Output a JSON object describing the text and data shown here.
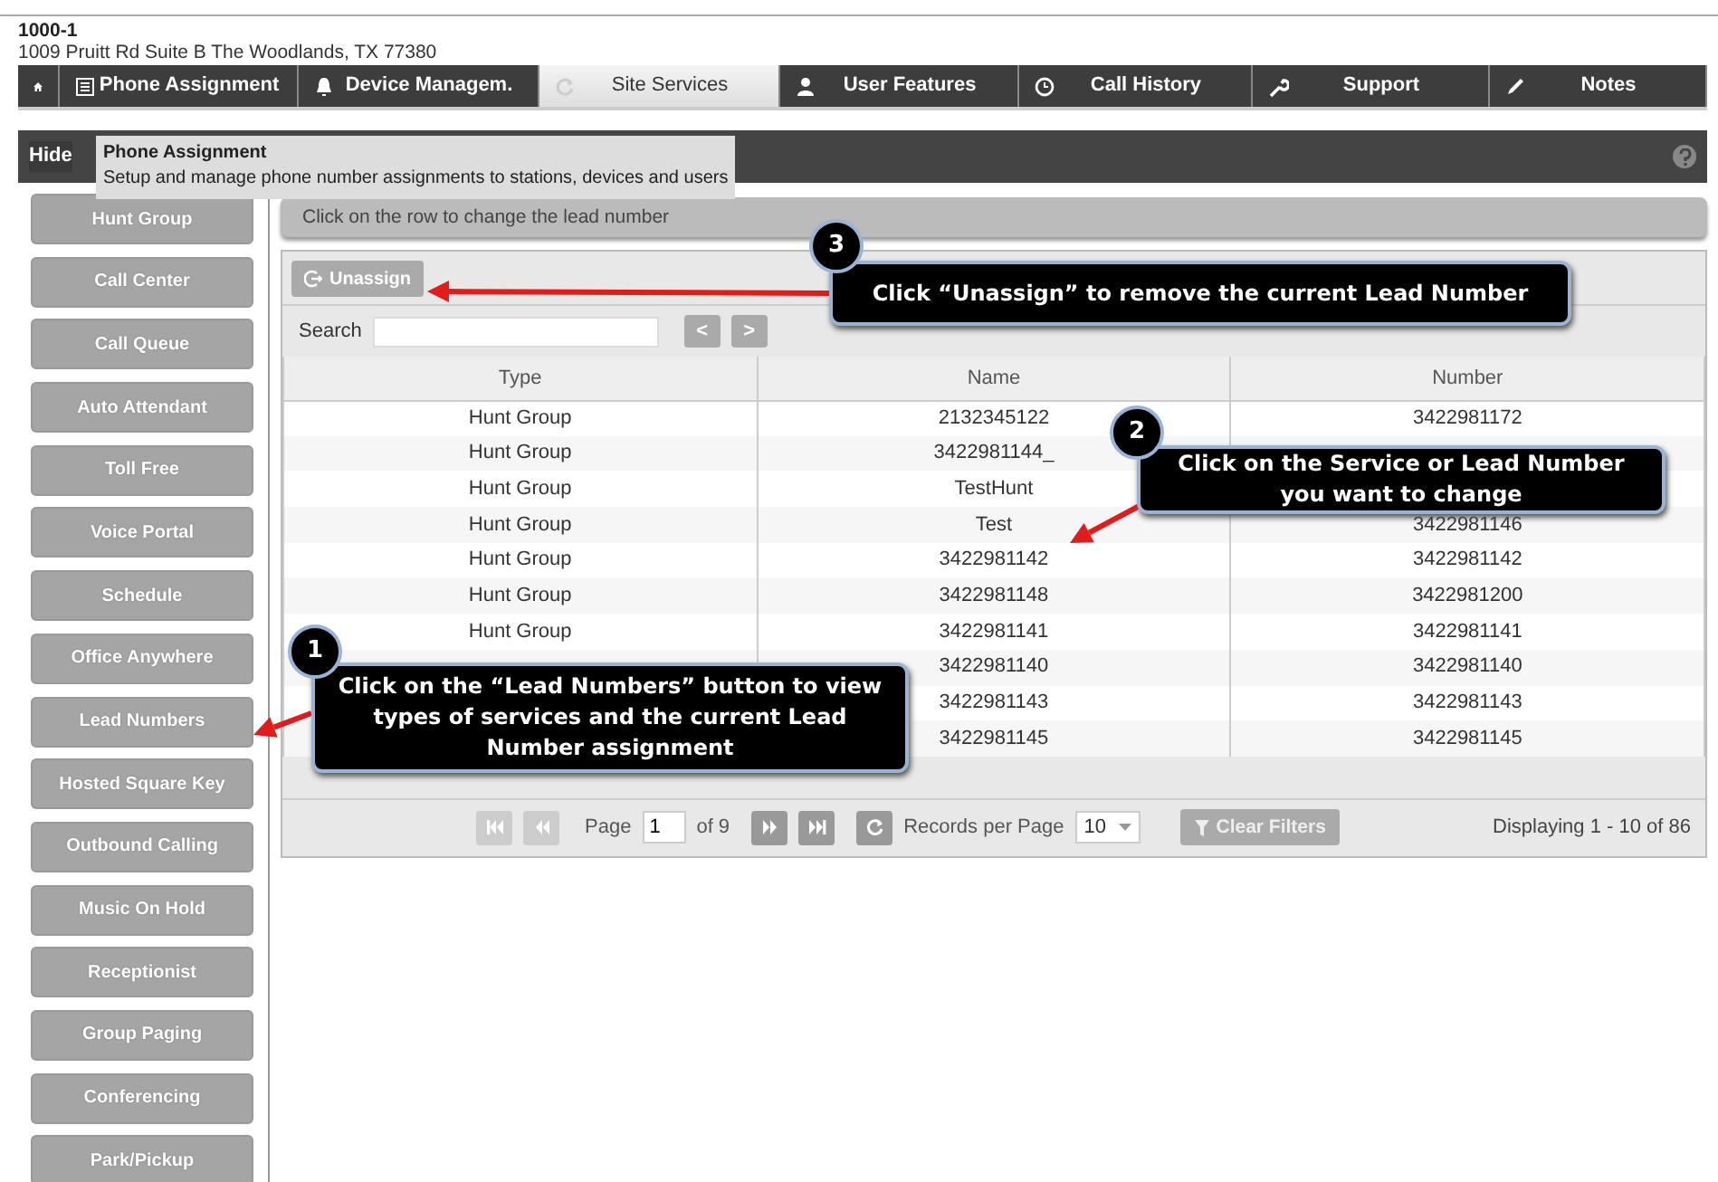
{
  "header": {
    "code": "1000-1",
    "address": "1009 Pruitt Rd Suite B The Woodlands, TX 77380"
  },
  "tabs": [
    {
      "selected": false
    },
    {
      "label": "Phone Assignment",
      "selected": false
    },
    {
      "label": "Device Managem.",
      "selected": false
    },
    {
      "label": "Site Services",
      "selected": true
    },
    {
      "label": "User Features",
      "selected": false
    },
    {
      "label": "Call History",
      "selected": false
    },
    {
      "label": "Support",
      "selected": false
    },
    {
      "label": "Notes",
      "selected": false
    }
  ],
  "banner": {
    "button": "Hide",
    "tooltip": {
      "title": "Phone Assignment",
      "text": "Setup and manage phone number assignments to stations, devices and users"
    }
  },
  "sidebar": {
    "items": [
      {
        "label": "Hunt Group"
      },
      {
        "label": "Call Center"
      },
      {
        "label": "Call Queue"
      },
      {
        "label": "Auto Attendant"
      },
      {
        "label": "Toll Free"
      },
      {
        "label": "Voice Portal"
      },
      {
        "label": "Schedule"
      },
      {
        "label": "Office Anywhere"
      },
      {
        "label": "Lead Numbers"
      },
      {
        "label": "Hosted Square Key"
      },
      {
        "label": "Outbound Calling"
      },
      {
        "label": "Music On Hold"
      },
      {
        "label": "Receptionist"
      },
      {
        "label": "Group Paging"
      },
      {
        "label": "Conferencing"
      },
      {
        "label": "Park/Pickup"
      }
    ]
  },
  "instruction": "Click on the row to change the lead number",
  "toolbar": {
    "unassign": {
      "label": "Unassign",
      "disabled": true
    }
  },
  "search": {
    "label": "Search",
    "prev": "<",
    "next": ">"
  },
  "table": {
    "columns": [
      "Type",
      "Name",
      "Number"
    ],
    "rows": [
      {
        "type": "Hunt Group",
        "name": "2132345122",
        "number": "3422981172"
      },
      {
        "type": "Hunt Group",
        "name": "3422981144_"
      },
      {
        "type": "Hunt Group",
        "name": "TestHunt"
      },
      {
        "type": "Hunt Group",
        "name": "Test",
        "number": "3422981146"
      },
      {
        "type": "Hunt Group",
        "name": "3422981142",
        "number": "3422981142"
      },
      {
        "type": "Hunt Group",
        "name": "3422981148",
        "number": "3422981200"
      },
      {
        "type": "Hunt Group",
        "name": "3422981141",
        "number": "3422981141"
      },
      {
        "name": "3422981140",
        "number": "3422981140"
      },
      {
        "name": "3422981143",
        "number": "3422981143"
      },
      {
        "name": "3422981145",
        "number": "3422981145"
      }
    ]
  },
  "pager": {
    "page_label": "Page",
    "page": "1",
    "of": "of 9",
    "records_label": "Records per Page",
    "per_page": "10",
    "clear_filters": "Clear Filters",
    "display": "Displaying 1 - 10 of 86"
  },
  "callouts": [
    {
      "number": "3",
      "text": "Click “Unassign” to remove the current Lead Number"
    },
    {
      "number": "2",
      "text": "Click on the Service or Lead Number you want to change"
    },
    {
      "number": "1",
      "text": "Click on the “Lead Numbers” button to view types of services and the current Lead Number assignment"
    }
  ]
}
